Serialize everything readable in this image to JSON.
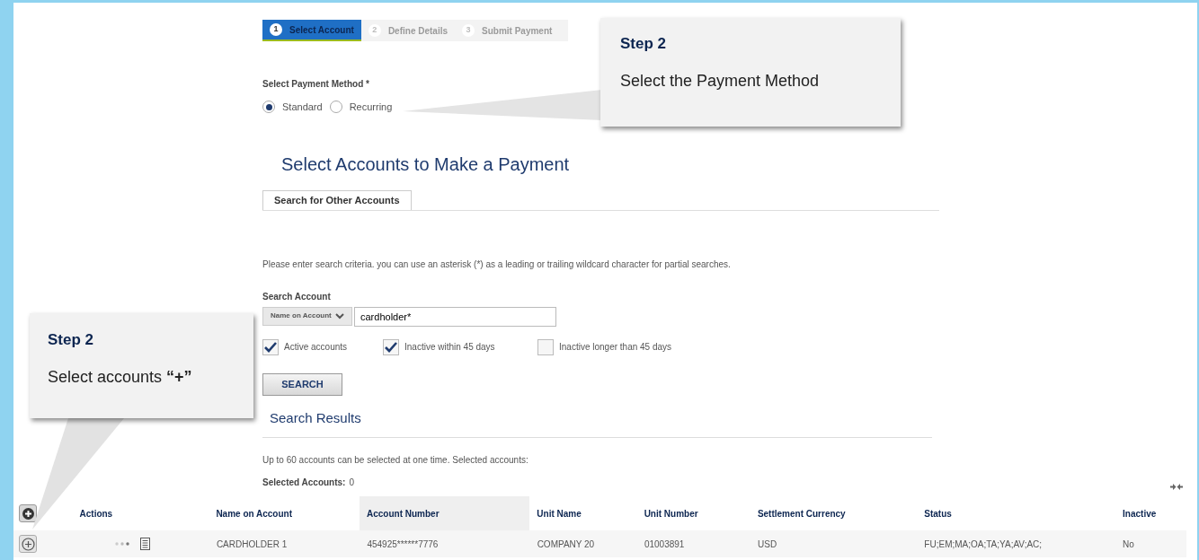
{
  "stepper": [
    {
      "number": "1",
      "label": "Select Account",
      "selected": true
    },
    {
      "number": "2",
      "label": "Define Details",
      "selected": false
    },
    {
      "number": "3",
      "label": "Submit Payment",
      "selected": false
    }
  ],
  "payment_method": {
    "label": "Select Payment Method *",
    "options": [
      {
        "label": "Standard",
        "selected": true
      },
      {
        "label": "Recurring",
        "selected": false
      }
    ]
  },
  "heading": "Select Accounts to Make a Payment",
  "tabs": [
    {
      "label": "Search for Other Accounts",
      "selected": true
    }
  ],
  "instructions": "Please enter search criteria. you can use an asterisk (*) as a leading or trailing wildcard character for partial searches.",
  "search": {
    "label": "Search Account",
    "field_selector": "Name on Account",
    "value": "cardholder*",
    "filters": [
      {
        "label": "Active accounts",
        "checked": true
      },
      {
        "label": "Inactive within 45 days",
        "checked": true
      },
      {
        "label": "Inactive longer than 45 days",
        "checked": false
      }
    ],
    "button": "SEARCH"
  },
  "results": {
    "title": "Search Results",
    "note": "Up to 60 accounts can be selected at one time. Selected accounts:",
    "selected_label": "Selected Accounts:",
    "selected_count": "0"
  },
  "table": {
    "columns": [
      "Actions",
      "Name on Account",
      "Account Number",
      "Unit Name",
      "Unit Number",
      "Settlement Currency",
      "Status",
      "Inactive"
    ],
    "rows": [
      [
        "",
        "CARDHOLDER 1",
        "454925******7776",
        "COMPANY 20",
        "01003891",
        "USD",
        "FU;EM;MA;OA;TA;YA;AV;AC;",
        "No"
      ]
    ]
  },
  "callouts": [
    {
      "title": "Step 2",
      "text": "Select the Payment Method"
    },
    {
      "title": "Step 2",
      "text": "Select accounts **“+”**"
    }
  ]
}
